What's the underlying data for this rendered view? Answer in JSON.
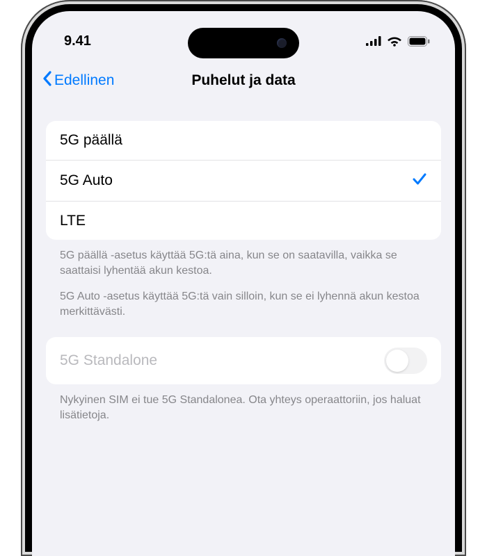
{
  "status": {
    "time": "9.41"
  },
  "nav": {
    "back_label": "Edellinen",
    "title": "Puhelut ja data"
  },
  "options": {
    "items": [
      {
        "label": "5G päällä",
        "selected": false
      },
      {
        "label": "5G Auto",
        "selected": true
      },
      {
        "label": "LTE",
        "selected": false
      }
    ],
    "footer_1": "5G päällä -asetus käyttää 5G:tä aina, kun se on saatavilla, vaikka se saattaisi lyhentää akun kestoa.",
    "footer_2": "5G Auto -asetus käyttää 5G:tä vain silloin, kun se ei lyhennä akun kestoa merkittävästi."
  },
  "standalone": {
    "label": "5G Standalone",
    "enabled": false,
    "available": false,
    "footer": "Nykyinen SIM ei tue 5G Standalonea. Ota yhteys operaattoriin, jos haluat lisätietoja."
  }
}
